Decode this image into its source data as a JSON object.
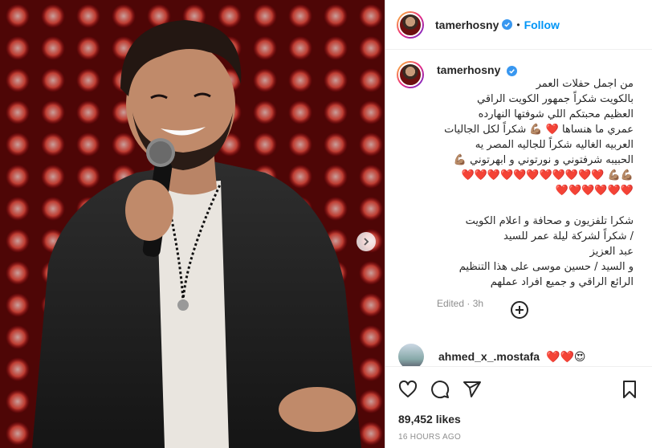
{
  "header": {
    "username": "tamerhosny",
    "separator": "•",
    "follow_label": "Follow"
  },
  "caption": {
    "username": "tamerhosny",
    "text": "من اجمل حفلات العمر\nبالكويت شكراً جمهور الكويت الراقي\nالعظيم محبتكم اللي شوفتها النهارده\nعمري ما هنساها ❤️ 💪🏽 شكراً لكل الجاليات\nالعربيه الغاليه شكراً للجاليه المصر يه\nالحبيبه شرفتوني و نورتوني و ابهرتوني 💪🏽\n💪🏽💪🏽 ❤️❤️❤️❤️❤️❤️❤️❤️❤️❤️❤️\n❤️❤️❤️❤️❤️❤️\n\nشكرا تلفزيون و صحافة و اعلام الكويت\n/ شكراً لشركة ليلة عمر للسيد\nعبد العزيز\nو السيد / حسين موسى على هذا التنظيم\nالرائع الراقي و جميع افراد عملهم",
    "edited_label": "Edited · 3h"
  },
  "load_more_icon": "plus-circle-icon",
  "comment": {
    "username": "ahmed_x_.mostafa",
    "text": "❤️❤️😍"
  },
  "actions": {
    "icons": [
      "heart-icon",
      "comment-icon",
      "share-icon",
      "bookmark-icon"
    ]
  },
  "likes_label": "89,452 likes",
  "timestamp": "16 HOURS AGO",
  "colors": {
    "accent": "#0095f6",
    "text": "#262626",
    "muted": "#8e8e8e",
    "border": "#dbdbdb"
  }
}
